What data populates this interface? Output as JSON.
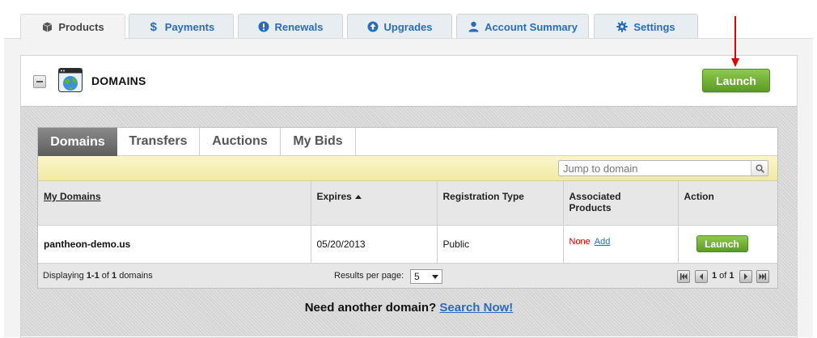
{
  "top_tabs": [
    {
      "label": "Products",
      "icon": "box-icon",
      "active": true
    },
    {
      "label": "Payments",
      "icon": "dollar-icon",
      "active": false
    },
    {
      "label": "Renewals",
      "icon": "alert-icon",
      "active": false
    },
    {
      "label": "Upgrades",
      "icon": "upgrade-arrow-icon",
      "active": false
    },
    {
      "label": "Account Summary",
      "icon": "user-icon",
      "active": false
    },
    {
      "label": "Settings",
      "icon": "gear-icon",
      "active": false
    }
  ],
  "card": {
    "title": "DOMAINS",
    "launch_label": "Launch"
  },
  "sub_tabs": [
    {
      "label": "Domains",
      "active": true
    },
    {
      "label": "Transfers",
      "active": false
    },
    {
      "label": "Auctions",
      "active": false
    },
    {
      "label": "My Bids",
      "active": false
    }
  ],
  "search": {
    "placeholder": "Jump to domain"
  },
  "table": {
    "headers": {
      "domains": "My Domains",
      "expires": "Expires",
      "registration": "Registration Type",
      "associated_line1": "Associated",
      "associated_line2": "Products",
      "action": "Action"
    },
    "rows": [
      {
        "domain": "pantheon-demo.us",
        "expires": "05/20/2013",
        "registration": "Public",
        "associated": "None",
        "add_label": "Add",
        "action_label": "Launch"
      }
    ]
  },
  "pager": {
    "display_prefix": "Displaying ",
    "display_range": "1-1",
    "display_mid": " of ",
    "display_total": "1",
    "display_suffix": " domains",
    "results_label": "Results per page:",
    "results_value": "5",
    "page_current": "1",
    "page_of": " of ",
    "page_total": "1"
  },
  "footer": {
    "question": "Need another domain?",
    "link": "Search Now!"
  },
  "colors": {
    "accent_blue": "#2b6cb8",
    "launch_green": "#6aac2f",
    "none_red": "#cc0000",
    "annotation_arrow": "#e00000"
  }
}
